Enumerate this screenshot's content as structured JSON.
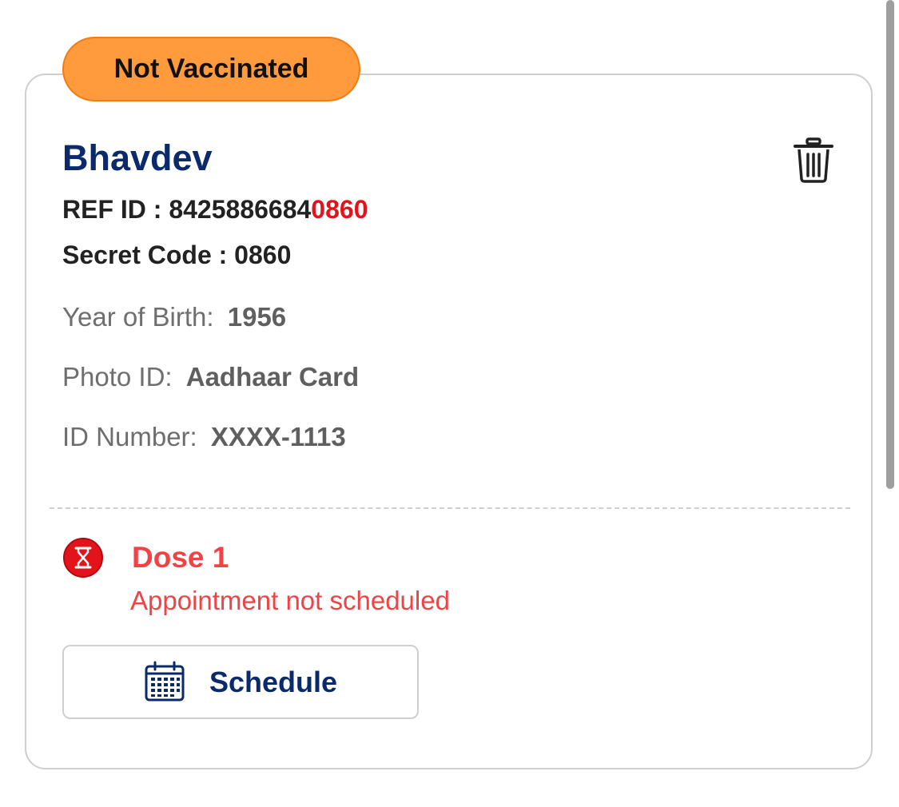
{
  "beneficiary": {
    "status_badge": "Not Vaccinated",
    "name": "Bhavdev",
    "ref_id_label": "REF ID : ",
    "ref_id_prefix": "8425886684",
    "ref_id_highlight": "0860",
    "secret_code": "Secret Code : 0860",
    "year_of_birth_label": "Year of Birth:",
    "year_of_birth": "1956",
    "photo_id_label": "Photo ID:",
    "photo_id": "Aadhaar Card",
    "id_number_label": "ID Number:",
    "id_number": "XXXX-1113"
  },
  "dose": {
    "title": "Dose 1",
    "status": "Appointment not scheduled",
    "schedule_label": "Schedule"
  },
  "icons": {
    "delete": "trash-icon",
    "dose": "hourglass-icon",
    "schedule": "calendar-icon"
  },
  "colors": {
    "badge_fill": "#ff9a3d",
    "name": "#0b2a6b",
    "highlight": "#e3131b",
    "dose_alert": "#ef4346"
  }
}
